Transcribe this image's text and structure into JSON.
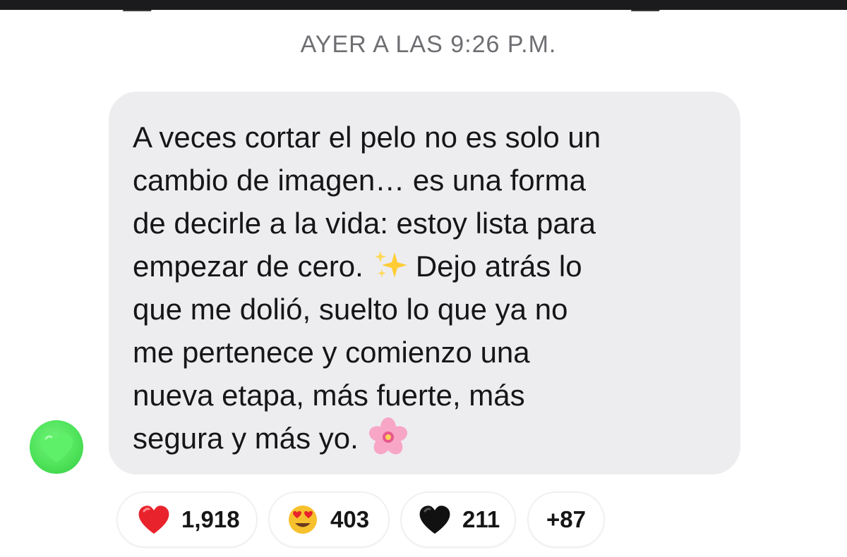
{
  "timestamp": "AYER A LAS 9:26 P.M.",
  "message": {
    "lines": [
      "A veces cortar el pelo no es solo un",
      "cambio de imagen… es una forma",
      "de decirle a la vida: estoy lista para",
      "empezar de cero.",
      "Dejo atrás lo",
      "que me dolió, suelto lo que ya no",
      "me pertenece y comienzo una",
      "nueva etapa, más fuerte, más",
      "segura y más yo."
    ],
    "emojis": [
      "sparkles-icon",
      "cherry-blossom-icon"
    ]
  },
  "sender_avatar": {
    "icon": "green-heart-icon",
    "color": "#4fe35a"
  },
  "reactions": [
    {
      "icon": "red-heart-icon",
      "count": "1,918",
      "color": "#e8232c"
    },
    {
      "icon": "heart-eyes-face-icon",
      "count": "403",
      "color": "#f7c12d"
    },
    {
      "icon": "black-heart-icon",
      "count": "211",
      "color": "#111111"
    },
    {
      "icon": "",
      "count": "+87"
    }
  ],
  "colors": {
    "bubble_background": "#ededf0",
    "text": "#161617",
    "timestamp": "#6e6e73"
  }
}
